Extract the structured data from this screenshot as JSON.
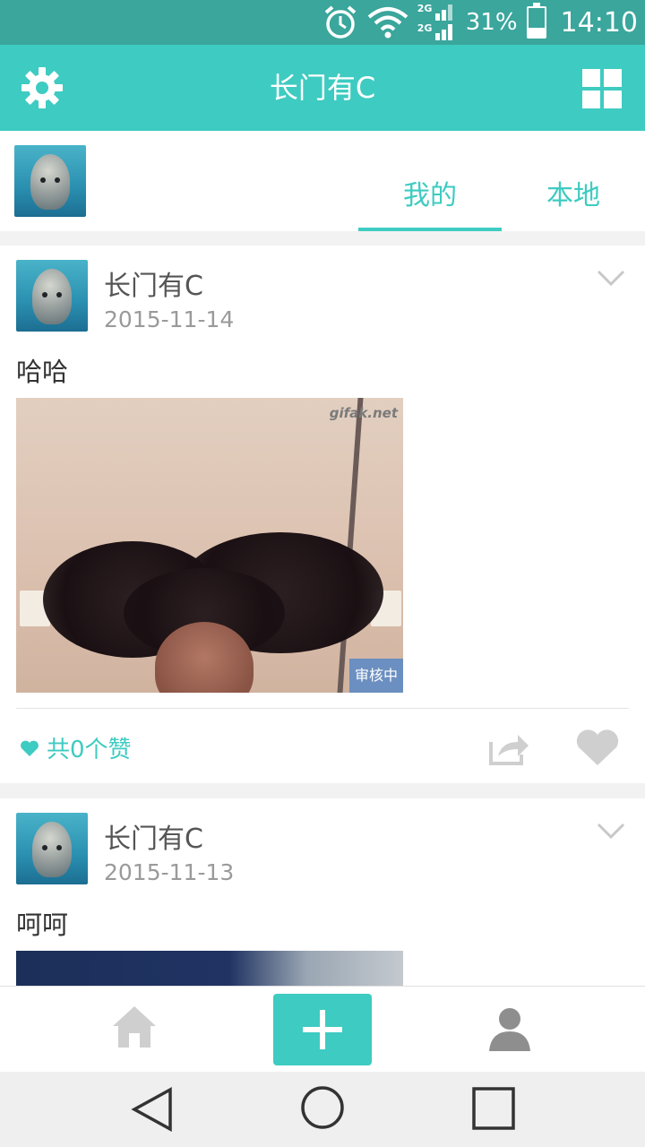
{
  "status_bar": {
    "network_top": "2G",
    "network_bottom": "2G",
    "battery_text": "31%",
    "battery_level": 0.31,
    "time": "14:10",
    "icons": [
      "alarm-icon",
      "wifi-icon",
      "signal-icon",
      "battery-icon"
    ]
  },
  "app_bar": {
    "title": "长门有C",
    "left_icon": "settings-gear-icon",
    "right_icon": "grid-menu-icon"
  },
  "tabs": [
    {
      "label": "我的",
      "active": true
    },
    {
      "label": "本地",
      "active": false
    }
  ],
  "posts": [
    {
      "author": "长门有C",
      "date": "2015-11-14",
      "text": "哈哈",
      "image_watermark": "gifak.net",
      "badge": "审核中",
      "likes_label": "共0个赞"
    },
    {
      "author": "长门有C",
      "date": "2015-11-13",
      "text": "呵呵"
    }
  ],
  "bottom_nav": {
    "items": [
      "home-icon",
      "add-icon",
      "profile-icon"
    ]
  },
  "colors": {
    "accent": "#3ecbc1",
    "status_bar": "#3aa69c",
    "badge": "#6b8fc0"
  }
}
